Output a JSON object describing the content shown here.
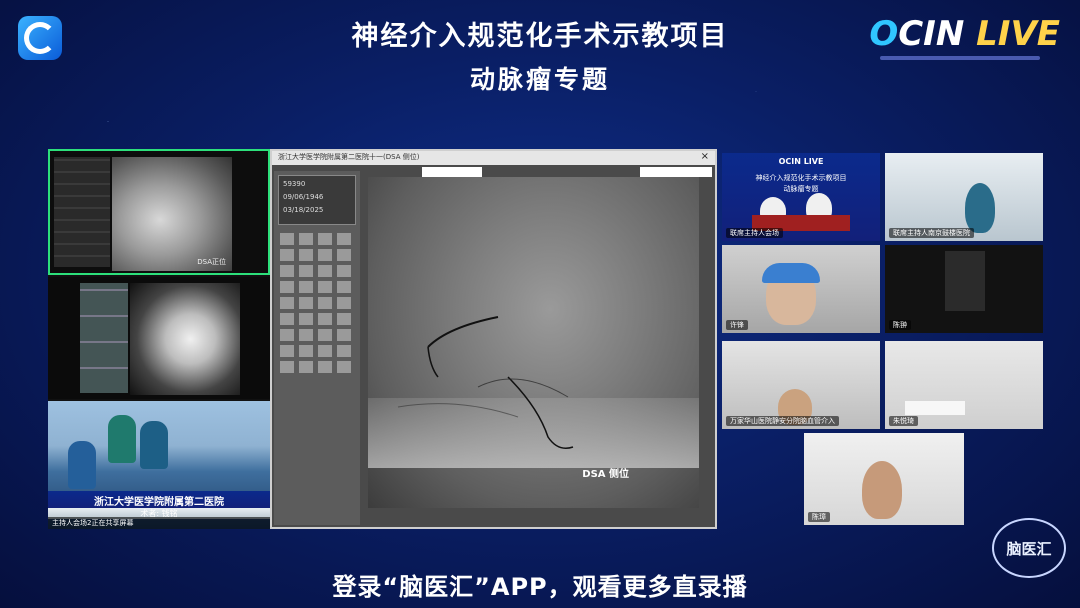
{
  "header": {
    "title": "神经介入规范化手术示教项目",
    "subtitle": "动脉瘤专题",
    "brand_o": "O",
    "brand_cin": "CIN",
    "brand_live": "LIVE"
  },
  "left": {
    "pane1_caption": "DSA正位",
    "pane3_hospital": "浙江大学医学院附属第二医院",
    "pane3_surgeon": "术者: 钱铭",
    "pane3_footer": "主持人会场2正在共享屏幕"
  },
  "main_window": {
    "title": "浙江大学医学院附属第二医院十一(DSA 侧位)",
    "close_glyph": "×",
    "patient": {
      "id": "59390",
      "dob": "09/06/1946",
      "date": "03/18/2025"
    },
    "image_label": "DSA 侧位"
  },
  "participants": [
    {
      "name": "联席主持人会场",
      "header": "OCIN LIVE",
      "title": "神经介入规范化手术示教项目",
      "subtitle": "动脉瘤专题"
    },
    {
      "name": "联席主持人南京鼓楼医院"
    },
    {
      "name": "许锋"
    },
    {
      "name": "陈翀"
    },
    {
      "name": "万家华山医院静安分院脑血管介入"
    },
    {
      "name": "朱悦琦"
    },
    {
      "name": "陈璋"
    }
  ],
  "brand_bottom": "脑医汇",
  "footer": "登录“脑医汇”APP，观看更多直录播"
}
